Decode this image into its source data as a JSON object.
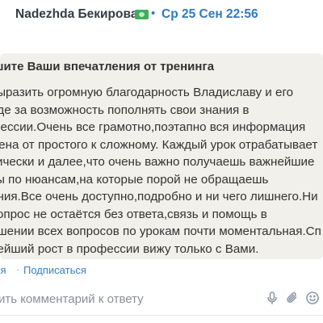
{
  "post": {
    "author": "Nadezhda Бекирова",
    "separator": "•",
    "date": "Ср 25 Сен 22:56",
    "title": "шите Ваши впечатления от тренинга",
    "body": " выразить огромную благодарность Владиславу и его\nнде за возможность пополнять свои знания в\nфессии.Очень все грамотно,поэтапно вся информация\nжена от простого к сложному. Каждый урок отрабатывает\nтически и далее,что очень важно получаешь важнейшие\nты по нюансам,на которые порой не обращаешь\nания.Все очень доступно,подробно и ни чего лишнего.Ни\n вопрос не остаётся без ответа,связь и помощь в\nешении всех вопросов по урокам почти моментальная.Сп\nнейший рост в профессии вижу только с Вами."
  },
  "actions": {
    "reply": "ся",
    "dot": "·",
    "subscribe": "Подписаться"
  },
  "comment": {
    "placeholder": "вить комментарий к ответу"
  },
  "icons": {
    "badge": "money-badge-icon",
    "mic": "microphone-icon",
    "attach": "paperclip-icon",
    "emoji": "smile-icon"
  },
  "colors": {
    "link": "#2f79c4",
    "card_bg": "#f1f0ea",
    "badge": "#3fae5a",
    "icon": "#8e98a6"
  }
}
